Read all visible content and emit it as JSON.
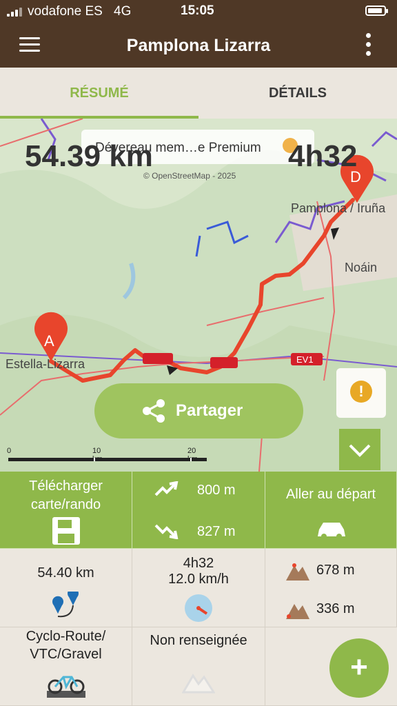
{
  "status_bar": {
    "carrier": "vodafone ES",
    "network": "4G",
    "time": "15:05"
  },
  "app_bar": {
    "title": "Pamplona Lizarra",
    "menu_icon": "hamburger-icon",
    "more_icon": "more-vertical-icon"
  },
  "tabs": [
    {
      "label": "RÉSUMÉ",
      "active": true
    },
    {
      "label": "DÉTAILS",
      "active": false
    }
  ],
  "map": {
    "distance": "54.39 km",
    "duration": "4h32",
    "premium_banner": "Dévereau mem…e Premium",
    "attribution": "© OpenStreetMap - 2025",
    "labels": {
      "start": "Estella-Lizarra",
      "end": "Pamplona / Iruña",
      "noain": "Noáin",
      "road": "EV1"
    },
    "markers": {
      "start": "A",
      "end": "D"
    },
    "share_label": "Partager",
    "scale": {
      "zero": "0",
      "mid": "10 km",
      "end": "20 km"
    }
  },
  "actions": {
    "download_label": "Télécharger carte/rando",
    "ascent": "800 m",
    "descent": "827 m",
    "goto_start_label": "Aller au départ"
  },
  "stats": {
    "distance": "54.40 km",
    "duration": "4h32",
    "speed": "12.0 km/h",
    "max_altitude": "678 m",
    "min_altitude": "336 m",
    "activity": "Cyclo-Route/ VTC/Gravel",
    "difficulty": "Non renseignée"
  },
  "colors": {
    "brand_brown": "#4f3826",
    "accent_green": "#8fb84a",
    "route_red": "#e8452c"
  }
}
